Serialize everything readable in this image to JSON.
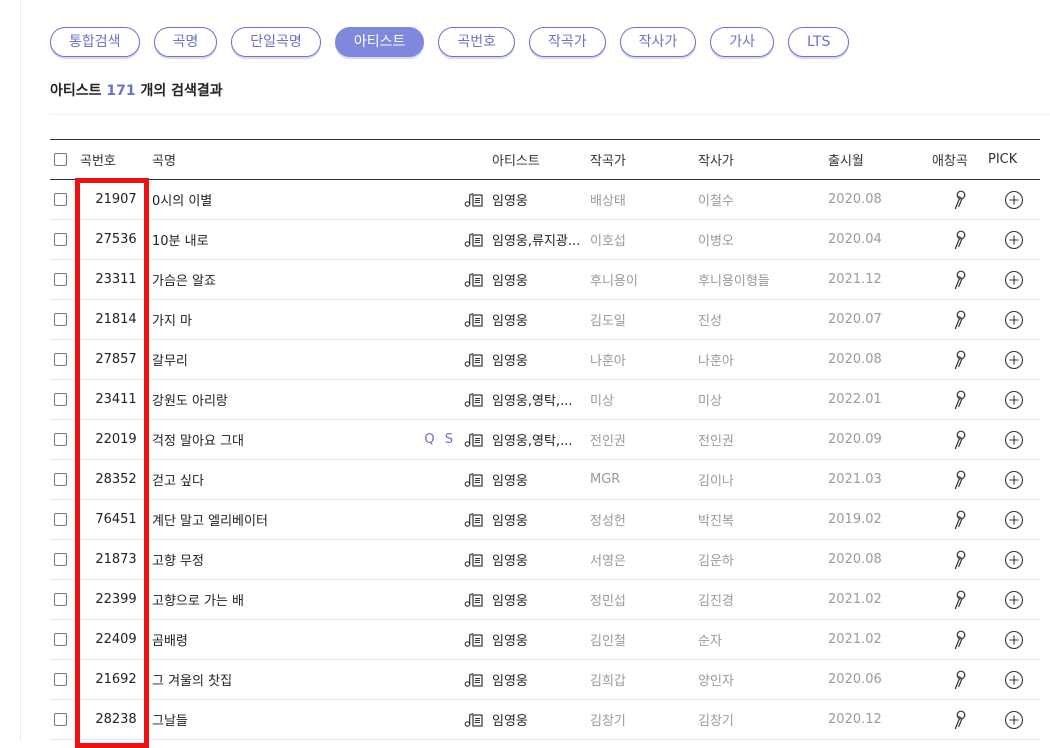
{
  "tabs": [
    {
      "label": "통합검색",
      "active": false
    },
    {
      "label": "곡명",
      "active": false
    },
    {
      "label": "단일곡명",
      "active": false
    },
    {
      "label": "아티스트",
      "active": true
    },
    {
      "label": "곡번호",
      "active": false
    },
    {
      "label": "작곡가",
      "active": false
    },
    {
      "label": "작사가",
      "active": false
    },
    {
      "label": "가사",
      "active": false
    },
    {
      "label": "LTS",
      "active": false
    }
  ],
  "summary": {
    "prefix": "아티스트",
    "count": "171",
    "suffix": "개의 검색결과"
  },
  "table": {
    "headers": {
      "number": "곡번호",
      "title": "곡명",
      "artist": "아티스트",
      "composer": "작곡가",
      "lyricist": "작사가",
      "release": "출시월",
      "favorite": "애창곡",
      "pick": "PICK"
    },
    "icons": {
      "sheet": "music-sheet-icon",
      "favorite": "microphone-icon",
      "pick": "plus-circle-icon"
    },
    "rows": [
      {
        "number": "21907",
        "title": "0시의 이별",
        "qs": "",
        "artist": "임영웅",
        "composer": "배상태",
        "lyricist": "이철수",
        "release": "2020.08"
      },
      {
        "number": "27536",
        "title": "10분 내로",
        "qs": "",
        "artist": "임영웅,류지광...",
        "composer": "이호섭",
        "lyricist": "이병오",
        "release": "2020.04"
      },
      {
        "number": "23311",
        "title": "가슴은 알죠",
        "qs": "",
        "artist": "임영웅",
        "composer": "후니용이",
        "lyricist": "후니용이형들",
        "release": "2021.12"
      },
      {
        "number": "21814",
        "title": "가지 마",
        "qs": "",
        "artist": "임영웅",
        "composer": "김도일",
        "lyricist": "진성",
        "release": "2020.07"
      },
      {
        "number": "27857",
        "title": "갈무리",
        "qs": "",
        "artist": "임영웅",
        "composer": "나훈아",
        "lyricist": "나훈아",
        "release": "2020.08"
      },
      {
        "number": "23411",
        "title": "강원도 아리랑",
        "qs": "",
        "artist": "임영웅,영탁,...",
        "composer": "미상",
        "lyricist": "미상",
        "release": "2022.01"
      },
      {
        "number": "22019",
        "title": "걱정 말아요 그대",
        "qs": "Q S",
        "artist": "임영웅,영탁,...",
        "composer": "전인권",
        "lyricist": "전인권",
        "release": "2020.09"
      },
      {
        "number": "28352",
        "title": "걷고 싶다",
        "qs": "",
        "artist": "임영웅",
        "composer": "MGR",
        "lyricist": "김이나",
        "release": "2021.03"
      },
      {
        "number": "76451",
        "title": "계단 말고 엘리베이터",
        "qs": "",
        "artist": "임영웅",
        "composer": "정성헌",
        "lyricist": "박진복",
        "release": "2019.02"
      },
      {
        "number": "21873",
        "title": "고향 무정",
        "qs": "",
        "artist": "임영웅",
        "composer": "서영은",
        "lyricist": "김운하",
        "release": "2020.08"
      },
      {
        "number": "22399",
        "title": "고향으로 가는 배",
        "qs": "",
        "artist": "임영웅",
        "composer": "정민섭",
        "lyricist": "김진경",
        "release": "2021.02"
      },
      {
        "number": "22409",
        "title": "곰배령",
        "qs": "",
        "artist": "임영웅",
        "composer": "김인철",
        "lyricist": "순자",
        "release": "2021.02"
      },
      {
        "number": "21692",
        "title": "그 겨울의 찻집",
        "qs": "",
        "artist": "임영웅",
        "composer": "김희갑",
        "lyricist": "양인자",
        "release": "2020.06"
      },
      {
        "number": "28238",
        "title": "그날들",
        "qs": "",
        "artist": "임영웅",
        "composer": "김창기",
        "lyricist": "김창기",
        "release": "2020.12"
      }
    ]
  },
  "colors": {
    "accent": "#6b73c9",
    "active_tab": "#7f88dd",
    "highlight": "#ee1111",
    "muted_text": "#9a9a9a"
  }
}
